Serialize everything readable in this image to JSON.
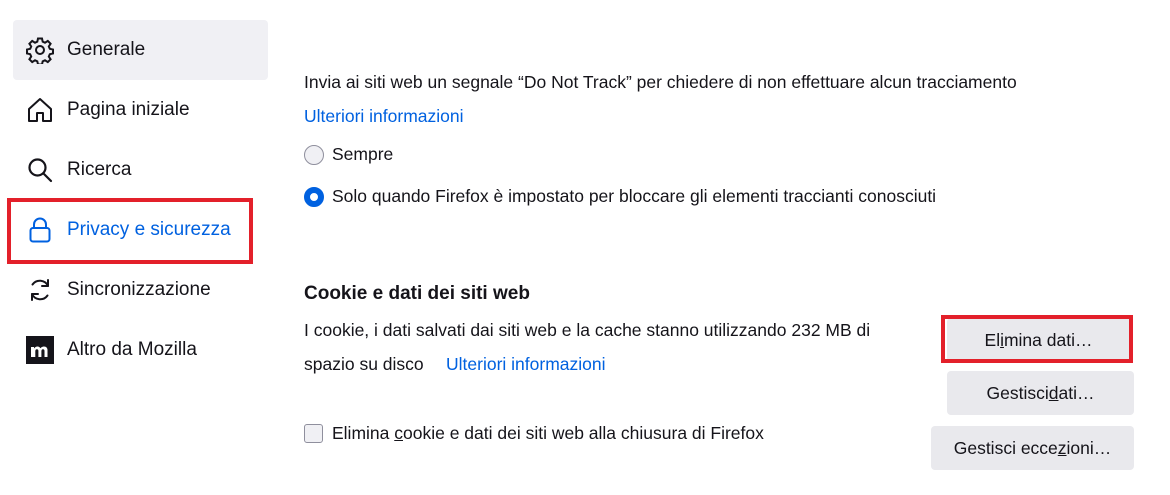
{
  "sidebar": {
    "items": [
      {
        "label": "Generale",
        "icon": "gear-icon"
      },
      {
        "label": "Pagina iniziale",
        "icon": "home-icon"
      },
      {
        "label": "Ricerca",
        "icon": "search-icon"
      },
      {
        "label": "Privacy e sicurezza",
        "icon": "lock-icon"
      },
      {
        "label": "Sincronizzazione",
        "icon": "sync-icon"
      },
      {
        "label": "Altro da Mozilla",
        "icon": "mozilla-logo-icon"
      }
    ]
  },
  "dnt": {
    "description": "Invia ai siti web un segnale “Do Not Track” per chiedere di non effettuare alcun tracciamento",
    "learn_more": "Ulteriori informazioni",
    "option_always": "Sempre",
    "option_when_blocking": "Solo quando Firefox è impostato per bloccare gli elementi traccianti conosciuti"
  },
  "cookies": {
    "title": "Cookie e dati dei siti web",
    "usage_line1": "I cookie, i dati salvati dai siti web e la cache stanno utilizzando 232 MB di",
    "usage_line2": "spazio su disco",
    "learn_more": "Ulteriori informazioni",
    "delete_on_close_pre": "Elimina ",
    "delete_on_close_key": "c",
    "delete_on_close_post": "ookie e dati dei siti web alla chiusura di Firefox",
    "clear_btn_pre": "El",
    "clear_btn_key": "i",
    "clear_btn_post": "mina dati…",
    "manage_btn_pre": "Gestisci ",
    "manage_btn_key": "d",
    "manage_btn_post": "ati…",
    "exceptions_btn_pre": "Gestisci ecce",
    "exceptions_btn_key": "z",
    "exceptions_btn_post": "ioni…"
  },
  "colors": {
    "accent": "#0061e0",
    "highlight": "#e3202a"
  }
}
